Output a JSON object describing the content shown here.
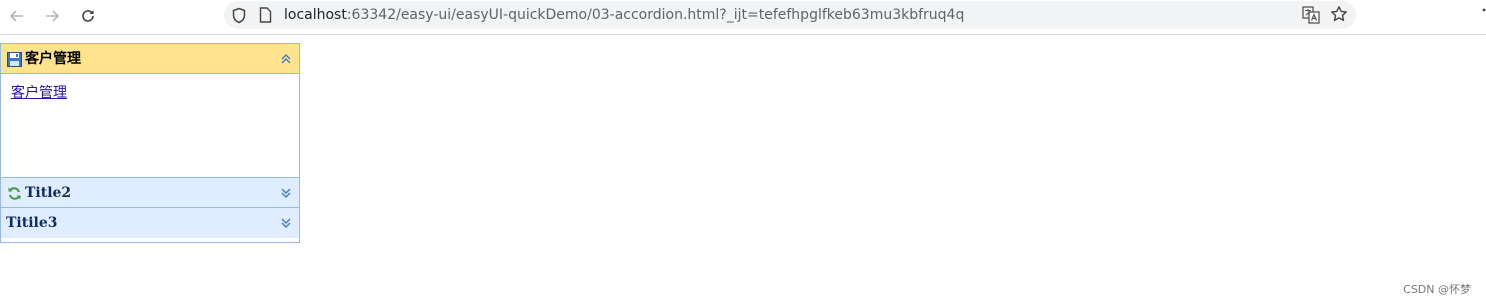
{
  "browser": {
    "url_host": "localhost",
    "url_rest": ":63342/easy-ui/easyUI-quickDemo/03-accordion.html?_ijt=tefefhpglfkeb63mu3kbfruq4q"
  },
  "accordion": {
    "panels": [
      {
        "title": "客户管理",
        "icon": "save-icon",
        "selected": true,
        "link": "客户管理"
      },
      {
        "title": "Title2",
        "icon": "reload-icon",
        "selected": false
      },
      {
        "title": "Titile3",
        "icon": "",
        "selected": false
      }
    ],
    "colors": {
      "selected_header": "#ffe48d",
      "header": "#e0ecff",
      "border": "#95b8e7"
    }
  },
  "watermark": "CSDN @怀梦"
}
